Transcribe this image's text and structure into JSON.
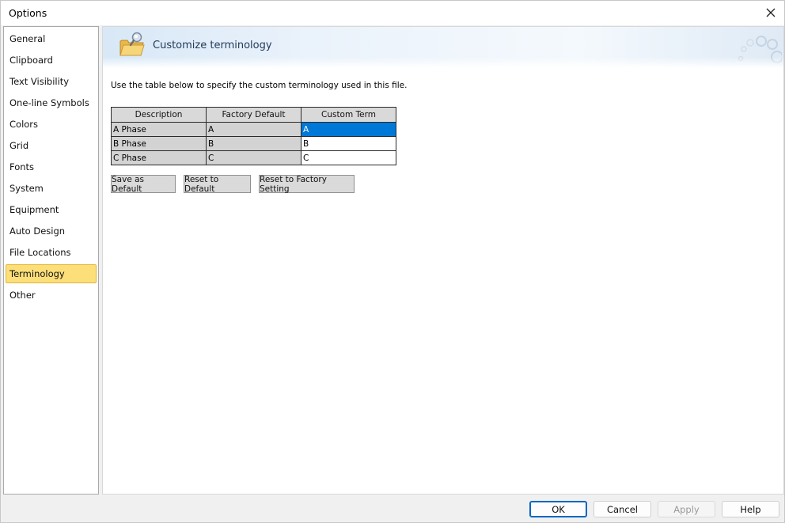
{
  "window": {
    "title": "Options"
  },
  "sidebar": {
    "items": [
      {
        "label": "General"
      },
      {
        "label": "Clipboard"
      },
      {
        "label": "Text Visibility"
      },
      {
        "label": "One-line Symbols"
      },
      {
        "label": "Colors"
      },
      {
        "label": "Grid"
      },
      {
        "label": "Fonts"
      },
      {
        "label": "System"
      },
      {
        "label": "Equipment"
      },
      {
        "label": "Auto Design"
      },
      {
        "label": "File Locations"
      },
      {
        "label": "Terminology"
      },
      {
        "label": "Other"
      }
    ],
    "selected": "Terminology"
  },
  "header": {
    "title": "Customize terminology",
    "icon": "folder-search-icon"
  },
  "main": {
    "description": "Use the table below to specify the custom terminology used in this file.",
    "table": {
      "columns": [
        "Description",
        "Factory Default",
        "Custom Term"
      ],
      "rows": [
        [
          "A Phase",
          "A",
          "A"
        ],
        [
          "B Phase",
          "B",
          "B"
        ],
        [
          "C Phase",
          "C",
          "C"
        ]
      ],
      "selected_cell": "A"
    },
    "buttons": {
      "save_default": "Save as Default",
      "reset_default": "Reset to Default",
      "reset_factory": "Reset to Factory Setting"
    }
  },
  "footer": {
    "ok": "OK",
    "cancel": "Cancel",
    "apply": "Apply",
    "help": "Help"
  },
  "colors": {
    "selection": "#0078d7",
    "sidebar_selected": "#fddf79"
  }
}
